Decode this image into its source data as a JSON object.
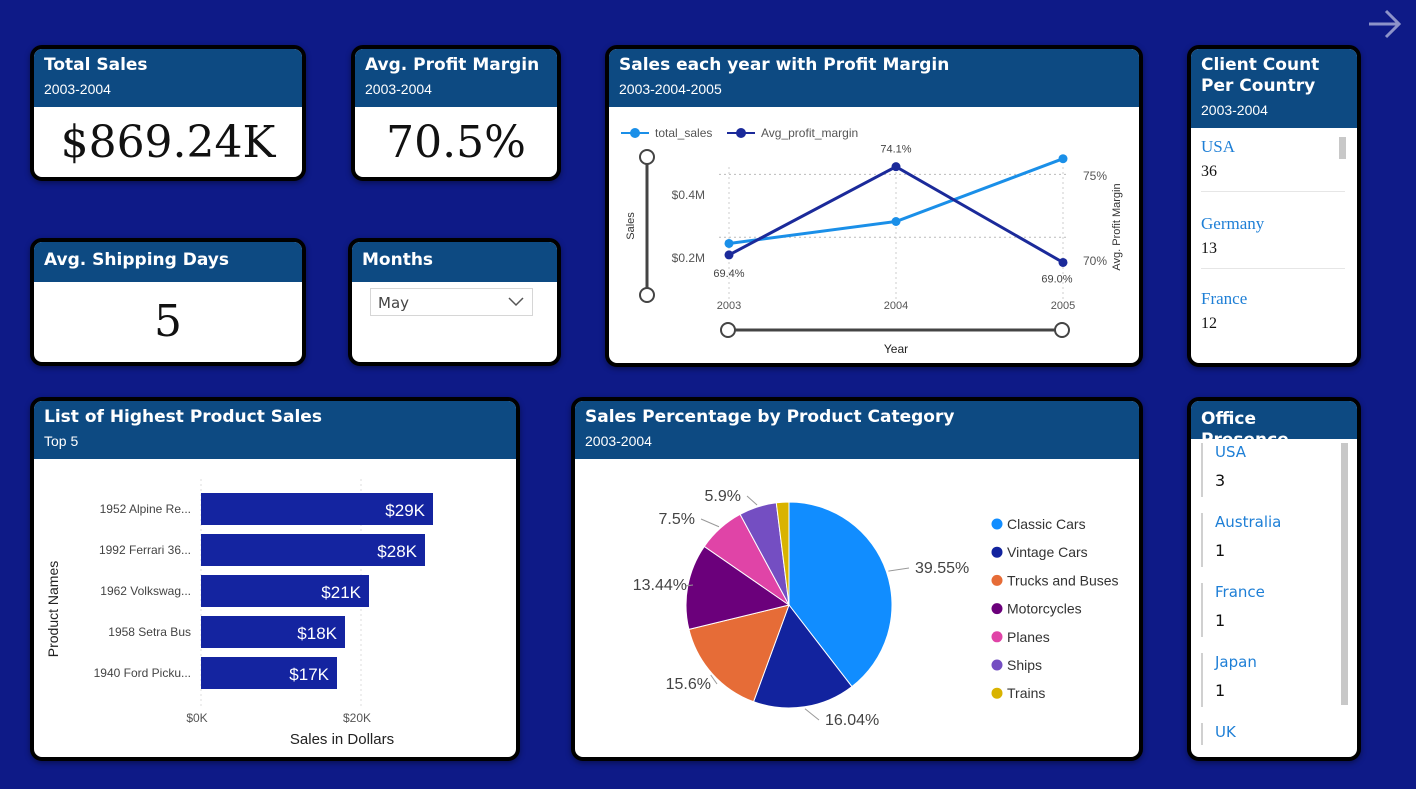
{
  "cards": {
    "total_sales": {
      "title": "Total Sales",
      "subtitle": "2003-2004",
      "value": "$869.24K"
    },
    "avg_profit": {
      "title": "Avg. Profit Margin",
      "subtitle": "2003-2004",
      "value": "70.5%"
    },
    "avg_shipping": {
      "title": "Avg. Shipping Days",
      "value": "5"
    },
    "months": {
      "title": "Months",
      "selected": "May"
    }
  },
  "line_chart": {
    "title": "Sales each year with Profit Margin",
    "subtitle": "2003-2004-2005",
    "legend": [
      "total_sales",
      "Avg_profit_margin"
    ],
    "y_left_label": "Sales",
    "y_right_label": "Avg. Profit Margin",
    "x_label": "Year",
    "y_left_ticks": [
      "$0.4M",
      "$0.2M"
    ],
    "y_right_ticks": [
      "75%",
      "70%"
    ],
    "x_ticks": [
      "2003",
      "2004",
      "2005"
    ],
    "margin_labels": [
      "69.4%",
      "74.1%",
      "69.0%"
    ]
  },
  "client_count": {
    "title": "Client Count Per Country",
    "subtitle": "2003-2004",
    "items": [
      {
        "name": "USA",
        "count": "36"
      },
      {
        "name": "Germany",
        "count": "13"
      },
      {
        "name": "France",
        "count": "12"
      }
    ]
  },
  "bar_chart": {
    "title": "List of Highest Product Sales",
    "subtitle": "Top 5",
    "y_label": "Product Names",
    "x_label": "Sales in Dollars",
    "x_ticks": [
      "$0K",
      "$20K"
    ]
  },
  "pie_chart": {
    "title": "Sales Percentage by Product Category",
    "subtitle": "2003-2004"
  },
  "office": {
    "title": "Office Presence",
    "items": [
      {
        "name": "USA",
        "count": "3"
      },
      {
        "name": "Australia",
        "count": "1"
      },
      {
        "name": "France",
        "count": "1"
      },
      {
        "name": "Japan",
        "count": "1"
      },
      {
        "name": "UK",
        "count": ""
      }
    ]
  },
  "colors": {
    "background": "#0e1a87",
    "header": "#0d4a82",
    "bar": "#1424a0",
    "line_sales": "#1a8fe8",
    "line_margin": "#1b2a9a"
  },
  "chart_data": [
    {
      "type": "line",
      "x": [
        "2003",
        "2004",
        "2005"
      ],
      "series": [
        {
          "name": "total_sales",
          "values": [
            0.18,
            0.25,
            0.45
          ],
          "axis": "left"
        },
        {
          "name": "Avg_profit_margin",
          "values": [
            69.4,
            74.1,
            69.0
          ],
          "axis": "right"
        }
      ],
      "title": "Sales each year with Profit Margin",
      "xlabel": "Year",
      "ylabel": "Sales",
      "y2label": "Avg. Profit Margin",
      "ylim": [
        0.0,
        0.5
      ],
      "y2lim": [
        67.0,
        76.0
      ],
      "grid": true,
      "legend": "top-left"
    },
    {
      "type": "bar",
      "categories": [
        "1952 Alpine Re...",
        "1992 Ferrari 36...",
        "1962 Volkswag...",
        "1958 Setra Bus",
        "1940 Ford Picku..."
      ],
      "values": [
        29,
        28,
        21,
        18,
        17
      ],
      "value_labels": [
        "$29K",
        "$28K",
        "$21K",
        "$18K",
        "$17K"
      ],
      "title": "List of Highest Product Sales",
      "xlabel": "Sales in Dollars",
      "ylabel": "Product Names",
      "xlim": [
        0,
        35
      ]
    },
    {
      "type": "pie",
      "categories": [
        "Classic Cars",
        "Vintage Cars",
        "Trucks and Buses",
        "Motorcycles",
        "Planes",
        "Ships",
        "Trains"
      ],
      "values": [
        39.55,
        16.04,
        15.6,
        13.44,
        7.5,
        5.9,
        1.97
      ],
      "labels": [
        "39.55%",
        "16.04%",
        "15.6%",
        "13.44%",
        "7.5%",
        "5.9%",
        ""
      ],
      "colors": [
        "#118dff",
        "#12239e",
        "#e66c37",
        "#6b007b",
        "#e044a7",
        "#744ec2",
        "#d9b300"
      ],
      "title": "Sales Percentage by Product Category",
      "legend": "right"
    }
  ]
}
